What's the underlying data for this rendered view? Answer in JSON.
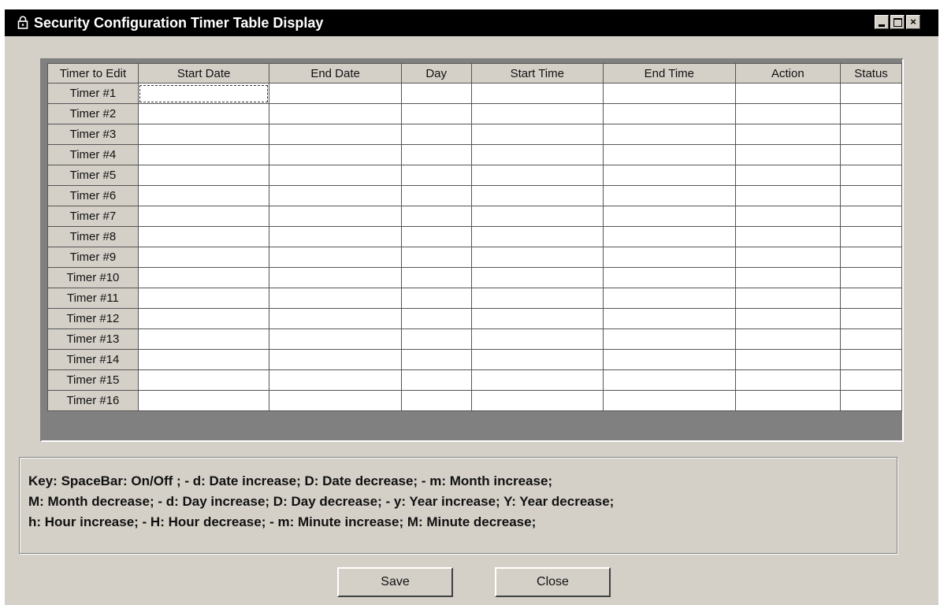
{
  "window": {
    "title": "Security Configuration Timer Table Display",
    "icon": "lock-icon",
    "controls": {
      "minimize": "minimize-icon",
      "maximize": "maximize-icon",
      "close_label": "×"
    }
  },
  "table": {
    "columns": [
      "Timer to Edit",
      "Start Date",
      "End Date",
      "Day",
      "Start Time",
      "End Time",
      "Action",
      "Status"
    ],
    "rows": [
      {
        "label": "Timer #1",
        "cells": [
          "",
          "",
          "",
          "",
          "",
          "",
          ""
        ]
      },
      {
        "label": "Timer #2",
        "cells": [
          "",
          "",
          "",
          "",
          "",
          "",
          ""
        ]
      },
      {
        "label": "Timer #3",
        "cells": [
          "",
          "",
          "",
          "",
          "",
          "",
          ""
        ]
      },
      {
        "label": "Timer #4",
        "cells": [
          "",
          "",
          "",
          "",
          "",
          "",
          ""
        ]
      },
      {
        "label": "Timer #5",
        "cells": [
          "",
          "",
          "",
          "",
          "",
          "",
          ""
        ]
      },
      {
        "label": "Timer #6",
        "cells": [
          "",
          "",
          "",
          "",
          "",
          "",
          ""
        ]
      },
      {
        "label": "Timer #7",
        "cells": [
          "",
          "",
          "",
          "",
          "",
          "",
          ""
        ]
      },
      {
        "label": "Timer #8",
        "cells": [
          "",
          "",
          "",
          "",
          "",
          "",
          ""
        ]
      },
      {
        "label": "Timer #9",
        "cells": [
          "",
          "",
          "",
          "",
          "",
          "",
          ""
        ]
      },
      {
        "label": "Timer #10",
        "cells": [
          "",
          "",
          "",
          "",
          "",
          "",
          ""
        ]
      },
      {
        "label": "Timer #11",
        "cells": [
          "",
          "",
          "",
          "",
          "",
          "",
          ""
        ]
      },
      {
        "label": "Timer #12",
        "cells": [
          "",
          "",
          "",
          "",
          "",
          "",
          ""
        ]
      },
      {
        "label": "Timer #13",
        "cells": [
          "",
          "",
          "",
          "",
          "",
          "",
          ""
        ]
      },
      {
        "label": "Timer #14",
        "cells": [
          "",
          "",
          "",
          "",
          "",
          "",
          ""
        ]
      },
      {
        "label": "Timer #15",
        "cells": [
          "",
          "",
          "",
          "",
          "",
          "",
          ""
        ]
      },
      {
        "label": "Timer #16",
        "cells": [
          "",
          "",
          "",
          "",
          "",
          "",
          ""
        ]
      }
    ]
  },
  "key": {
    "line1": "Key:  SpaceBar:  On/Off ;  -  d: Date increase; D: Date decrease;  -   m: Month increase;",
    "line2": "M: Month decrease; -   d: Day increase; D: Day decrease; -   y: Year increase;  Y: Year decrease;",
    "line3": "h: Hour increase; -  H: Hour decrease; - m: Minute increase; M: Minute decrease;"
  },
  "buttons": {
    "save_label": "Save",
    "close_label": "Close"
  },
  "colors": {
    "titlebar": "#000000",
    "window": "#d4d0c8",
    "cell": "#ffffff"
  }
}
